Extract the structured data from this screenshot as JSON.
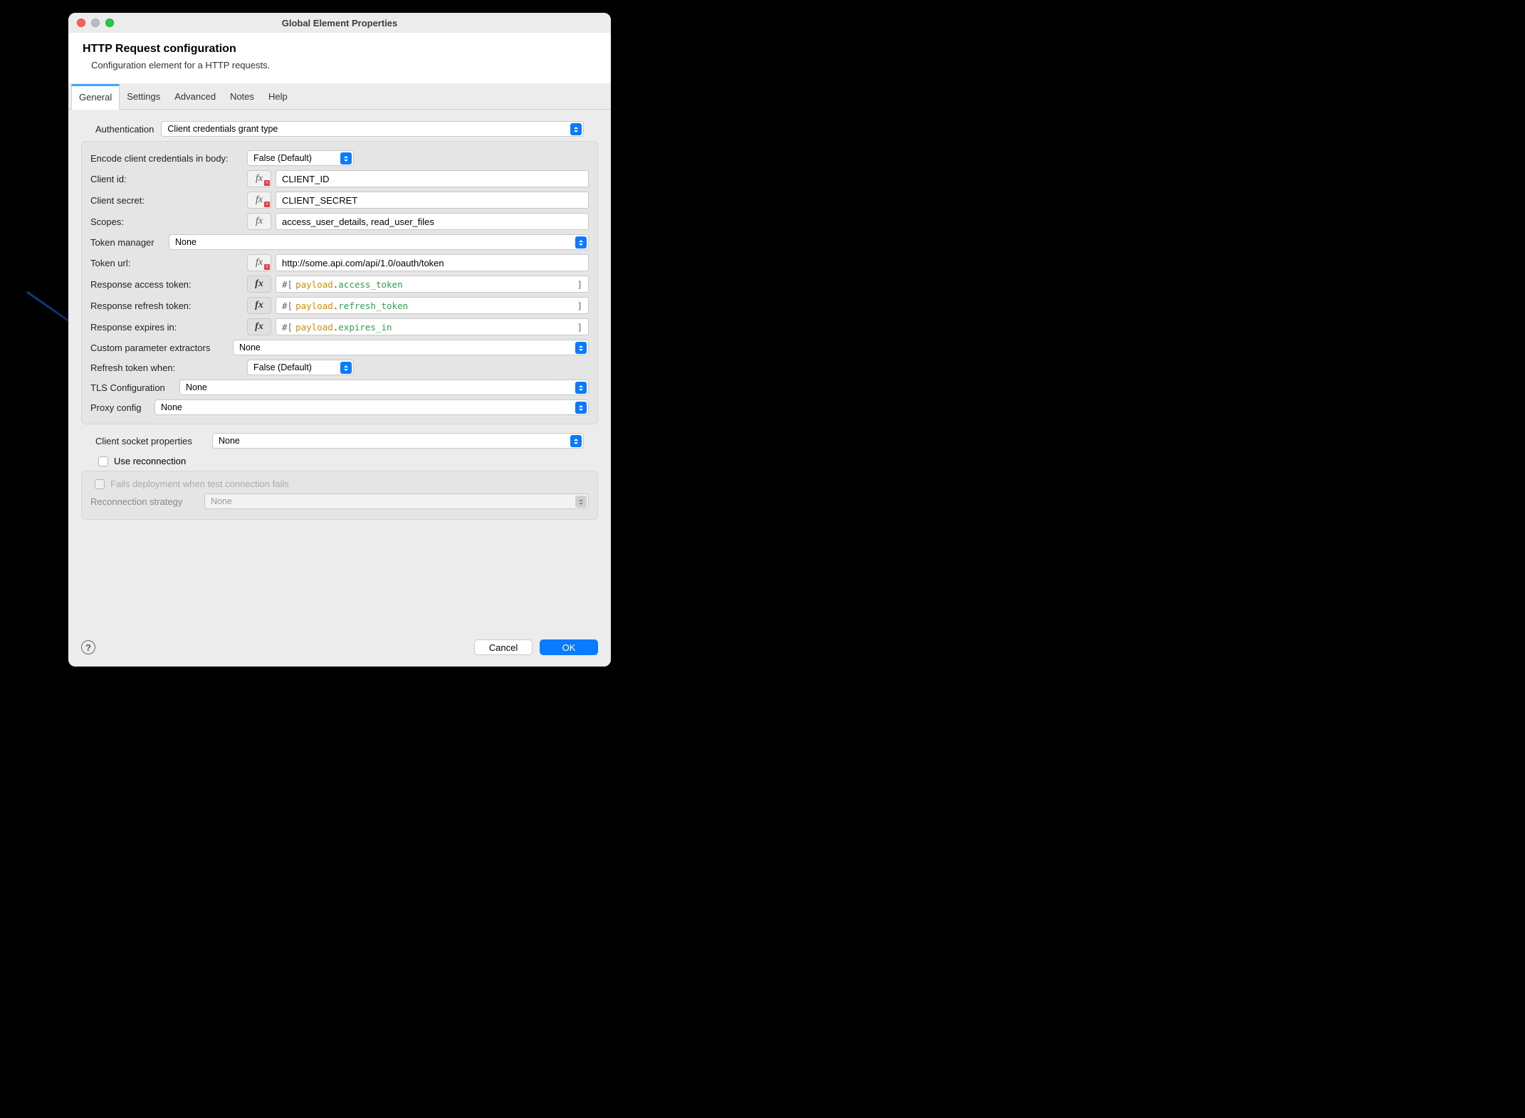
{
  "window": {
    "title": "Global Element Properties"
  },
  "header": {
    "title": "HTTP Request configuration",
    "subtitle": "Configuration element for a HTTP requests."
  },
  "tabs": [
    "General",
    "Settings",
    "Advanced",
    "Notes",
    "Help"
  ],
  "auth": {
    "label": "Authentication",
    "value": "Client credentials grant type"
  },
  "fields": {
    "encode_body": {
      "label": "Encode client credentials in body:",
      "value": "False (Default)"
    },
    "client_id": {
      "label": "Client id:",
      "value": "CLIENT_ID"
    },
    "client_secret": {
      "label": "Client secret:",
      "value": "CLIENT_SECRET"
    },
    "scopes": {
      "label": "Scopes:",
      "value": "access_user_details, read_user_files"
    },
    "token_manager": {
      "label": "Token manager",
      "value": "None"
    },
    "token_url": {
      "label": "Token url:",
      "value": "http://some.api.com/api/1.0/oauth/token"
    },
    "resp_access": {
      "label": "Response access token:",
      "prefix": "#[",
      "obj": "payload",
      "attr": "access_token",
      "suffix": "]"
    },
    "resp_refresh": {
      "label": "Response refresh token:",
      "prefix": "#[",
      "obj": "payload",
      "attr": "refresh_token",
      "suffix": "]"
    },
    "resp_expires": {
      "label": "Response expires in:",
      "prefix": "#[",
      "obj": "payload",
      "attr": "expires_in",
      "suffix": "]"
    },
    "custom_extractors": {
      "label": "Custom parameter extractors",
      "value": "None"
    },
    "refresh_when": {
      "label": "Refresh token when:",
      "value": "False (Default)"
    },
    "tls_config": {
      "label": "TLS Configuration",
      "value": "None"
    },
    "proxy_config": {
      "label": "Proxy config",
      "value": "None"
    }
  },
  "client_socket": {
    "label": "Client socket properties",
    "value": "None"
  },
  "reconnection": {
    "use_label": "Use reconnection",
    "fails_label": "Fails deployment when test connection fails",
    "strategy_label": "Reconnection strategy",
    "strategy_value": "None"
  },
  "footer": {
    "cancel": "Cancel",
    "ok": "OK"
  },
  "fx_glyph": "fx"
}
